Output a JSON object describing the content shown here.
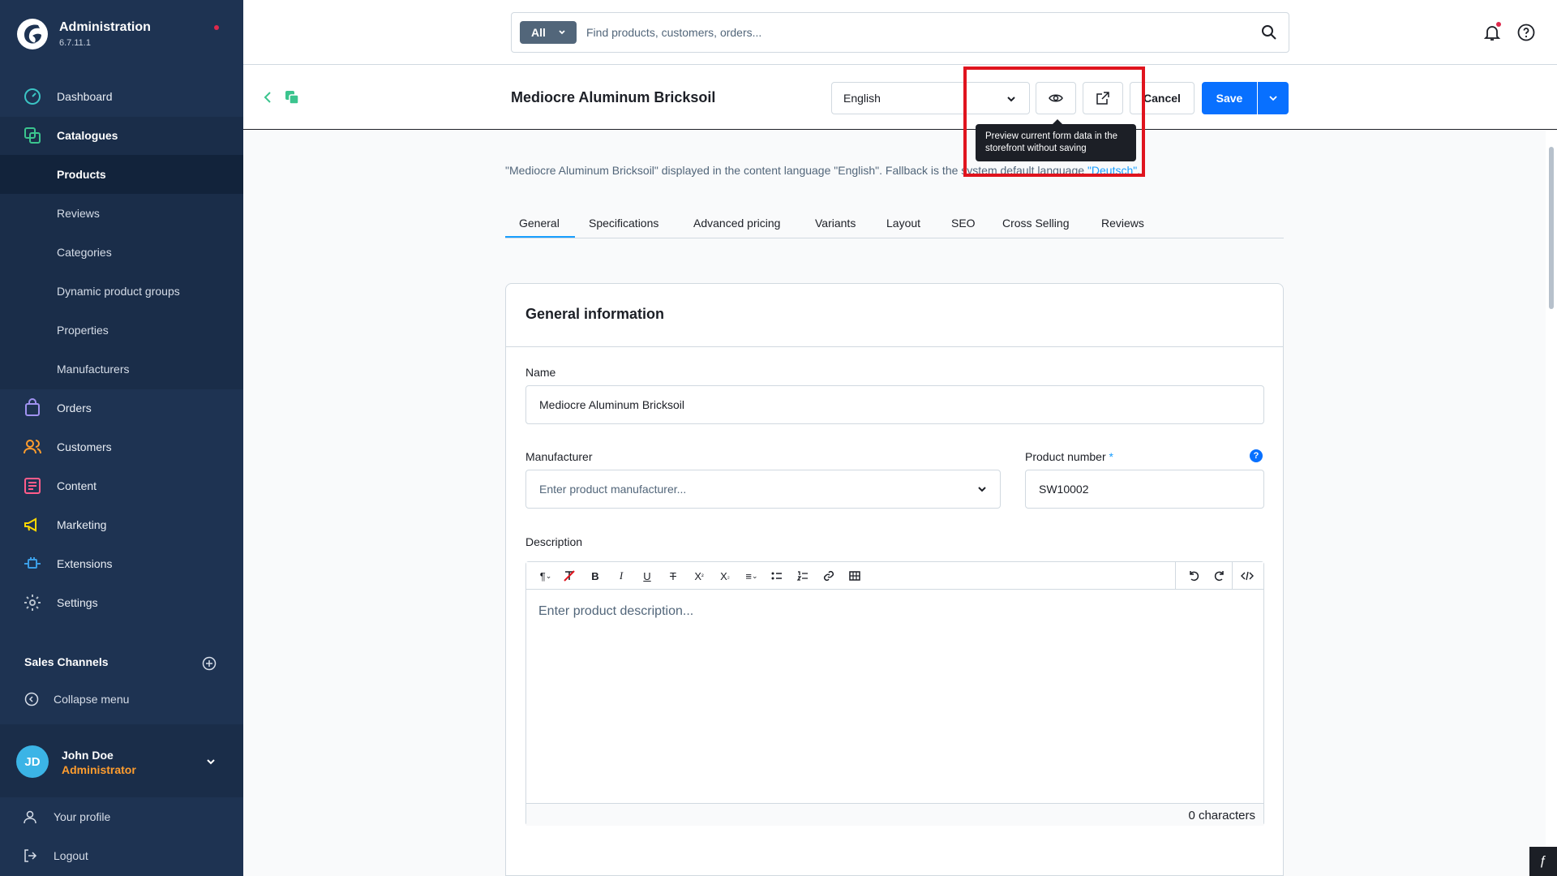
{
  "sidebar": {
    "brand_title": "Administration",
    "brand_version": "6.7.11.1",
    "nav": [
      {
        "label": "Dashboard"
      },
      {
        "label": "Catalogues"
      },
      {
        "label": "Orders"
      },
      {
        "label": "Customers"
      },
      {
        "label": "Content"
      },
      {
        "label": "Marketing"
      },
      {
        "label": "Extensions"
      },
      {
        "label": "Settings"
      }
    ],
    "catalogue_sub": [
      {
        "label": "Products"
      },
      {
        "label": "Reviews"
      },
      {
        "label": "Categories"
      },
      {
        "label": "Dynamic product groups"
      },
      {
        "label": "Properties"
      },
      {
        "label": "Manufacturers"
      }
    ],
    "sales_channels": "Sales Channels",
    "collapse_menu": "Collapse menu",
    "user": {
      "initials": "JD",
      "name": "John Doe",
      "role": "Administrator"
    },
    "footer": {
      "profile": "Your profile",
      "logout": "Logout"
    },
    "colors": {
      "bg": "#1e3352",
      "accent_orange": "#ff9d2e",
      "avatar": "#3bb4e6"
    }
  },
  "topbar": {
    "search_scope": "All",
    "search_placeholder": "Find products, customers, orders..."
  },
  "smartbar": {
    "title": "Mediocre Aluminum Bricksoil",
    "language": "English",
    "cancel": "Cancel",
    "save": "Save",
    "tooltip": "Preview current form data in the storefront without saving"
  },
  "notice": {
    "prefix": "\"Mediocre Aluminum Bricksoil\" displayed in the content language \"English\". Fallback is the system default language ",
    "link": "\"Deutsch\"",
    "suffix": "."
  },
  "tabs": [
    {
      "label": "General"
    },
    {
      "label": "Specifications"
    },
    {
      "label": "Advanced pricing"
    },
    {
      "label": "Variants"
    },
    {
      "label": "Layout"
    },
    {
      "label": "SEO"
    },
    {
      "label": "Cross Selling"
    },
    {
      "label": "Reviews"
    }
  ],
  "card": {
    "title": "General information",
    "name_label": "Name",
    "name_value": "Mediocre Aluminum Bricksoil",
    "manufacturer_label": "Manufacturer",
    "manufacturer_placeholder": "Enter product manufacturer...",
    "product_number_label": "Product number",
    "required_mark": "*",
    "product_number_value": "SW10002",
    "info_mark": "?",
    "description_label": "Description",
    "description_placeholder": "Enter product description...",
    "char_count": "0 characters"
  },
  "colors": {
    "primary": "#0870ff",
    "link": "#189eff",
    "highlight": "#e0141e"
  }
}
